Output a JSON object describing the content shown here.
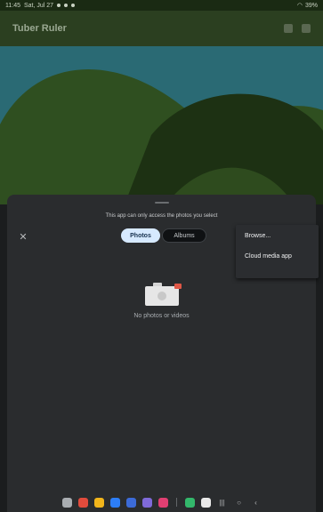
{
  "status_bar": {
    "time": "11:45",
    "date": "Sat, Jul 27",
    "battery": "39%"
  },
  "app_bar": {
    "title": "Tuber Ruler",
    "icons": [
      "camera-icon",
      "more-icon"
    ]
  },
  "picker": {
    "notice": "This app can only access the photos you select",
    "tabs": [
      {
        "label": "Photos",
        "selected": true
      },
      {
        "label": "Albums",
        "selected": false
      }
    ],
    "empty_message": "No photos or videos"
  },
  "overflow_menu": {
    "items": [
      {
        "label": "Browse..."
      },
      {
        "label": "Cloud media app"
      }
    ]
  },
  "nav_bar": {
    "apps": [
      {
        "name": "app-drawer-icon",
        "color": "#a9adb1"
      },
      {
        "name": "red-app-icon",
        "color": "#e14b3c"
      },
      {
        "name": "orange-app-icon",
        "color": "#f2b51b"
      },
      {
        "name": "blue-app-icon",
        "color": "#2d7ef7"
      },
      {
        "name": "chat-app-icon",
        "color": "#3c6bd8"
      },
      {
        "name": "purple-app-icon",
        "color": "#7f6ad9"
      },
      {
        "name": "pink-app-icon",
        "color": "#e03f72"
      },
      {
        "name": "play-store-icon",
        "color": "#33b86b"
      },
      {
        "name": "google-icon",
        "color": "#e9e9e9"
      }
    ],
    "buttons": [
      "recent-apps",
      "home",
      "back"
    ]
  },
  "colors": {
    "sky": "#2a6a74",
    "hill_light": "#2f4f20",
    "hill_dark": "#1d3113",
    "sheet": "#2a2c2e"
  }
}
